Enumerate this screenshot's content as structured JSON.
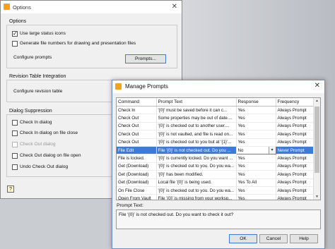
{
  "options": {
    "title": "Options",
    "sections": {
      "options_label": "Options",
      "large_icons": "Use large status icons",
      "file_numbers": "Generate file numbers for drawing and presentation files",
      "configure_prompts_label": "Configure prompts",
      "prompts_button": "Prompts...",
      "revision_label": "Revision Table Integration",
      "configure_revision_label": "Configure revision table",
      "dialog_suppression_label": "Dialog Suppression",
      "checkin_dialog": "Check In dialog",
      "checkin_close": "Check In dialog on file close",
      "checkout_dialog": "Check Out dialog",
      "checkout_open": "Check Out dialog on file open",
      "undo_checkout": "Undo Check Out dialog"
    },
    "help_icon": "?"
  },
  "manage_prompts": {
    "title": "Manage Prompts",
    "close_glyph": "✕",
    "columns": [
      "Command",
      "Prompt Text",
      "Response",
      "Frequency"
    ],
    "rows": [
      {
        "command": "Check In",
        "prompt": "'{0}' must be saved before it can c...",
        "response": "Yes",
        "frequency": "Always Prompt"
      },
      {
        "command": "Check Out",
        "prompt": "Some properties may be out of date....",
        "response": "Yes",
        "frequency": "Always Prompt"
      },
      {
        "command": "Check Out",
        "prompt": "'{0}' is checked out to another user....",
        "response": "Yes",
        "frequency": "Always Prompt"
      },
      {
        "command": "Check Out",
        "prompt": "'{0}' is not vaulted, and file is read on...",
        "response": "Yes",
        "frequency": "Always Prompt"
      },
      {
        "command": "Check Out",
        "prompt": "'{0}' is checked out to you but at '{1}'...",
        "response": "Yes",
        "frequency": "Always Prompt"
      },
      {
        "command": "File Edit",
        "prompt": "File '{0}' is not checked out. Do you ...",
        "response": "No",
        "frequency": "Never Prompt",
        "selected": true
      },
      {
        "command": "File is locked.",
        "prompt": "'{0}' is currently locked. Do you want ...",
        "response": "Yes",
        "frequency": "Always Prompt"
      },
      {
        "command": "Get (Download)",
        "prompt": "'{0}' is checked out to you. Do you wa...",
        "response": "Yes",
        "frequency": "Always Prompt"
      },
      {
        "command": "Get (Download)",
        "prompt": "'{0}' has been modified.",
        "response": "Yes",
        "frequency": "Always Prompt"
      },
      {
        "command": "Get (Download)",
        "prompt": "Local file '{0}' is being used.",
        "response": "Yes To All",
        "frequency": "Always Prompt"
      },
      {
        "command": "On File Close",
        "prompt": "'{0}' is checked out to you. Do you wa...",
        "response": "Yes",
        "frequency": "Always Prompt"
      },
      {
        "command": "Open From Vault",
        "prompt": "File '{0}' is missing from your worksp...",
        "response": "Yes",
        "frequency": "Always Prompt"
      }
    ],
    "prompt_text_label": "Prompt Text:",
    "prompt_text_value": "File '{0}' is not checked out. Do you want to check it out?",
    "ok_label": "OK",
    "cancel_label": "Cancel",
    "help_label": "Help"
  }
}
